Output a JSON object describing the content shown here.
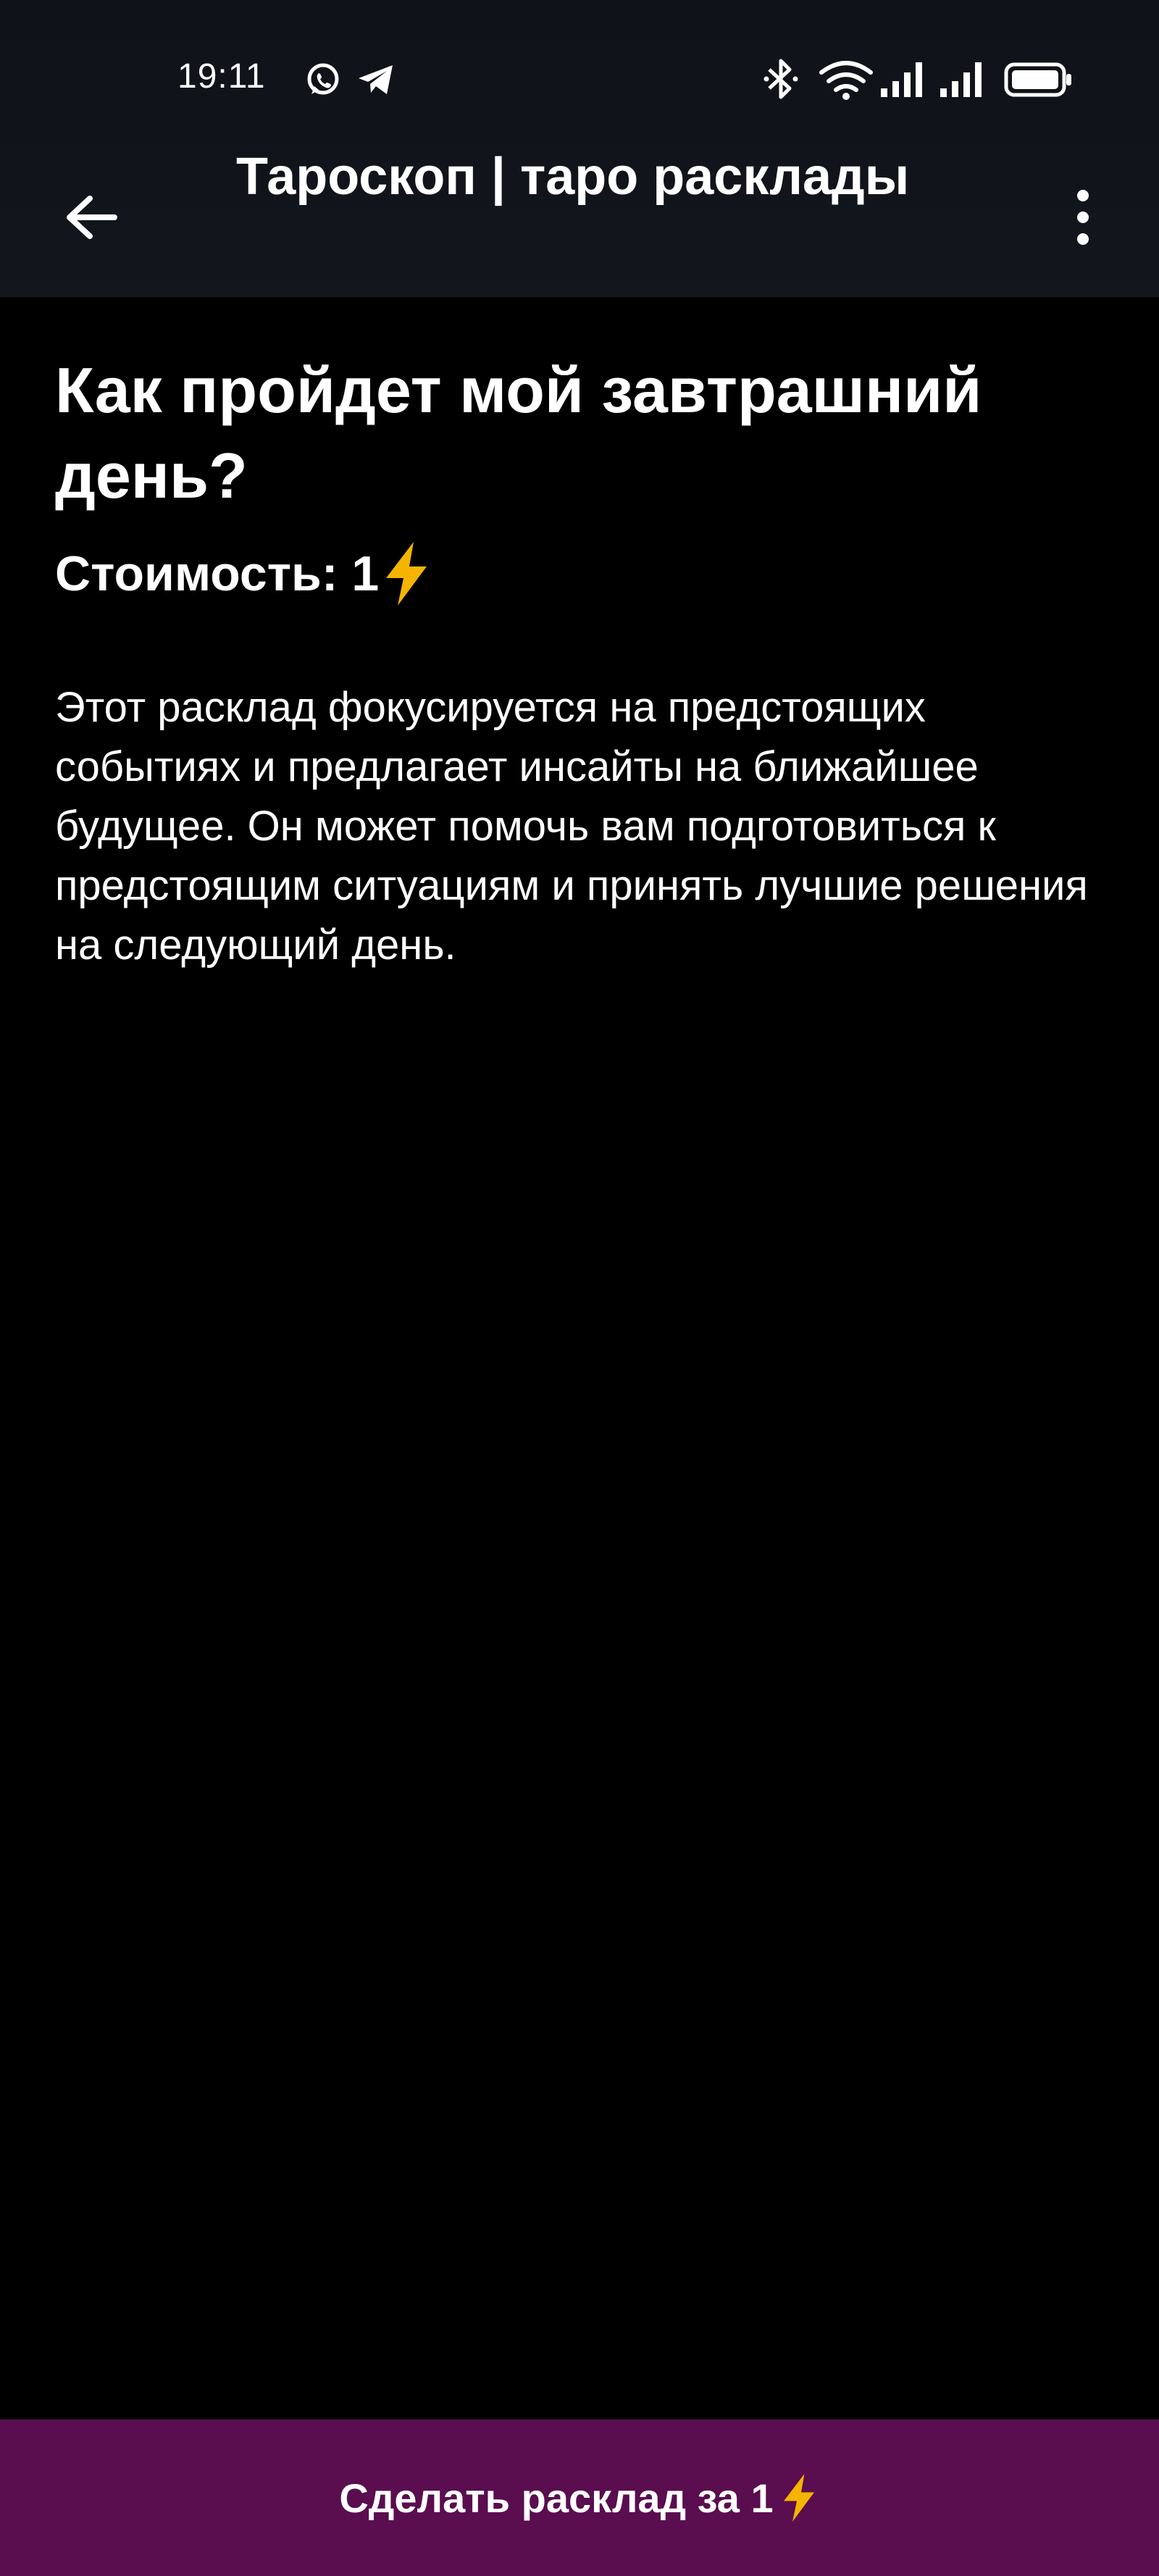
{
  "status_bar": {
    "time": "19:11",
    "icons": [
      "whatsapp-icon",
      "telegram-icon",
      "bluetooth-icon",
      "wifi-icon",
      "signal-icon",
      "signal-icon",
      "battery-icon"
    ]
  },
  "app_bar": {
    "title": "Тароскоп | таро расклады",
    "back_icon": "arrow-left-icon",
    "menu_icon": "more-vertical-icon"
  },
  "spread": {
    "title": "Как пройдет мой завтрашний день?",
    "cost_label": "Стоимость: 1",
    "cost_icon": "lightning-icon",
    "description": "Этот расклад фокусируется на предстоящих событиях и предлагает инсайты на ближайшее будущее. Он может помочь вам подготовиться к предстоящим ситуациям и принять лучшие решения на следующий день."
  },
  "action": {
    "button_label": "Сделать расклад за 1",
    "button_icon": "lightning-icon"
  },
  "colors": {
    "background": "#000000",
    "top_bar": "#12161d",
    "button_background": "#5a0d4f",
    "lightning": "#f5b400"
  }
}
